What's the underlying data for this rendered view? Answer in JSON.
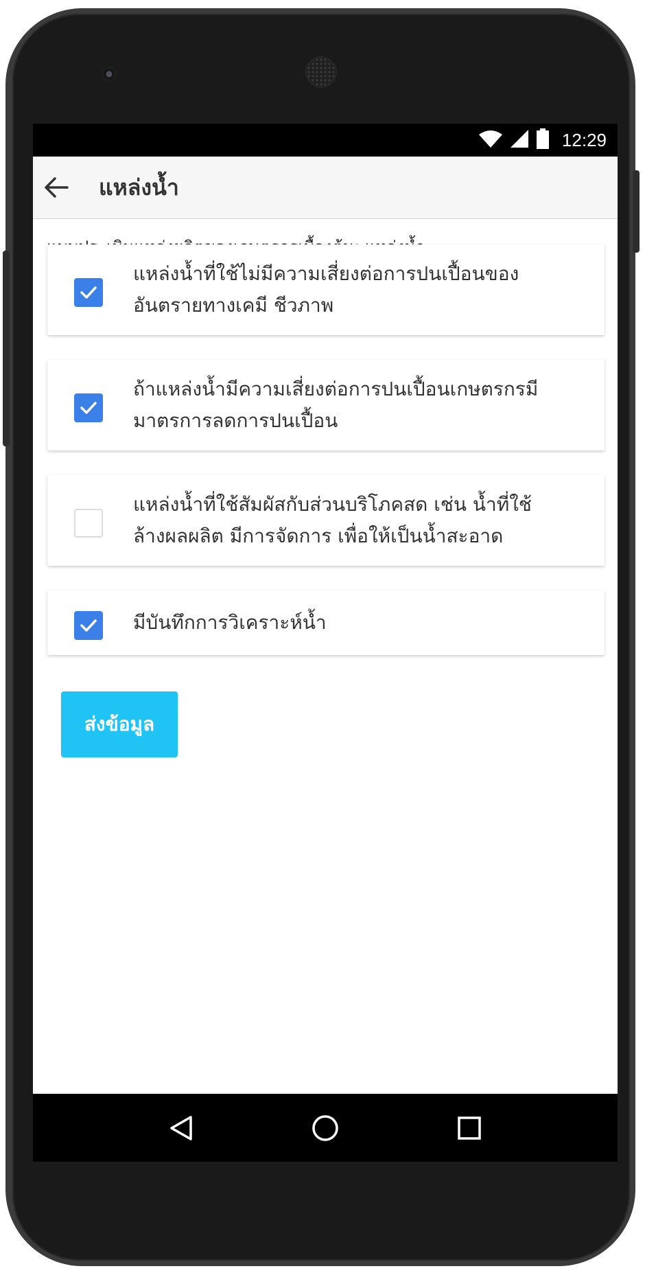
{
  "status_bar": {
    "time": "12:29",
    "icons": [
      "wifi-icon",
      "cell-signal-icon",
      "battery-icon"
    ]
  },
  "app_bar": {
    "back_icon": "arrow-left-icon",
    "title": "แหล่งน้ำ"
  },
  "subtitle": "แบบประเมินแหล่งผลิตของเกษตรกรเบื้องต้น: แหล่งน้ำ",
  "items": [
    {
      "checked": true,
      "lines": [
        "แหล่งน้ำที่ใช้ไม่มีความเสี่ยงต่อการปนเปื้อนของ",
        "อันตรายทางเคมี ชีวภาพ"
      ]
    },
    {
      "checked": true,
      "lines": [
        "ถ้าแหล่งน้ำมีความเสี่ยงต่อการปนเปื้อนเกษตรกรมี",
        "มาตรการลดการปนเปื้อน"
      ]
    },
    {
      "checked": false,
      "lines": [
        "แหล่งน้ำที่ใช้สัมผัสกับส่วนบริโภคสด เช่น น้ำที่ใช้",
        "ล้างผลผลิต มีการจัดการ เพื่อให้เป็นน้ำสะอาด"
      ]
    },
    {
      "checked": true,
      "lines": [
        "มีบันทึกการวิเคราะห์น้ำ"
      ]
    }
  ],
  "submit_label": "ส่งข้อมูล",
  "nav_bar": {
    "icons": [
      "back-triangle-icon",
      "home-circle-icon",
      "recents-square-icon"
    ]
  },
  "colors": {
    "checkbox_checked": "#3b7fe8",
    "submit_button": "#1fc3f4",
    "app_bar_bg": "#f6f6f6"
  }
}
